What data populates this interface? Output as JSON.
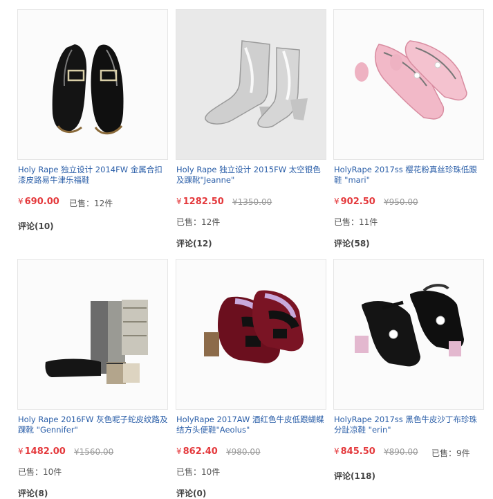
{
  "products": [
    {
      "title": "Holy Rape 独立设计 2014FW 金属合扣漆皮路易牛津乐福鞋",
      "currency": "¥",
      "price": "690.00",
      "old_price": "",
      "sold": "已售：12件",
      "reviews": "评论(10)"
    },
    {
      "title": "Holy Rape 独立设计 2015FW 太空银色及踝靴\"Jeanne\"",
      "currency": "¥",
      "price": "1282.50",
      "old_price": "¥1350.00",
      "sold": "已售：12件",
      "reviews": "评论(12)"
    },
    {
      "title": "HolyRape 2017ss 樱花粉真丝珍珠低跟鞋 \"mari\"",
      "currency": "¥",
      "price": "902.50",
      "old_price": "¥950.00",
      "sold": "已售：11件",
      "reviews": "评论(58)"
    },
    {
      "title": "Holy Rape 2016FW 灰色呢子蛇皮纹路及踝靴 \"Gennifer\"",
      "currency": "¥",
      "price": "1482.00",
      "old_price": "¥1560.00",
      "sold": "已售：10件",
      "reviews": "评论(8)"
    },
    {
      "title": "HolyRape 2017AW 酒红色牛皮低跟蝴蝶结方头便鞋\"Aeolus\"",
      "currency": "¥",
      "price": "862.40",
      "old_price": "¥980.00",
      "sold": "已售：10件",
      "reviews": "评论(0)"
    },
    {
      "title": "HolyRape 2017ss 黑色牛皮沙丁布珍珠分趾凉鞋 \"erin\"",
      "currency": "¥",
      "price": "845.50",
      "old_price": "¥890.00",
      "sold": "已售：9件",
      "reviews": "评论(118)"
    }
  ]
}
